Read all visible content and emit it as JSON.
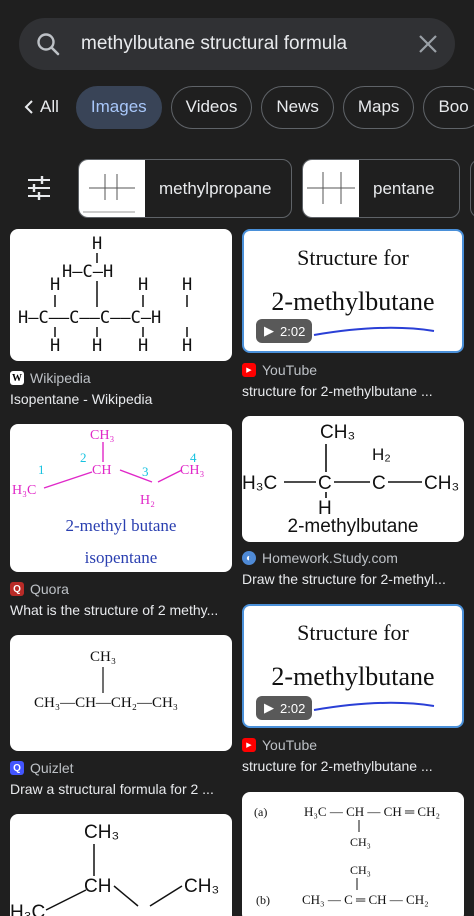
{
  "search": {
    "query": "methylbutane structural formula"
  },
  "tabs": [
    {
      "label": "All"
    },
    {
      "label": "Images"
    },
    {
      "label": "Videos"
    },
    {
      "label": "News"
    },
    {
      "label": "Maps"
    },
    {
      "label": "Boo"
    }
  ],
  "chips": [
    {
      "label": "methylpropane"
    },
    {
      "label": "pentane"
    }
  ],
  "results": [
    {
      "source": "Wikipedia",
      "title": "Isopentane - Wikipedia"
    },
    {
      "source": "YouTube",
      "title": "structure for 2-methylbutane ...",
      "duration": "2:02",
      "image_heading": "Structure for",
      "image_subheading": "2-methylbutane"
    },
    {
      "source": "Quora",
      "title": "What is the structure of 2 methy...",
      "image_text_1": "2-methyl butane",
      "image_text_2": "isopentane"
    },
    {
      "source": "Homework.Study.com",
      "title": "Draw the structure for 2-methyl...",
      "image_text": "2-methylbutane"
    },
    {
      "source": "Quizlet",
      "title": "Draw a structural formula for 2 ..."
    },
    {
      "source": "YouTube",
      "title": "structure for 2-methylbutane ...",
      "duration": "2:02",
      "image_heading": "Structure for",
      "image_subheading": "2-methylbutane"
    }
  ],
  "colors": {
    "youtube": "#ff0000",
    "quora": "#b92b27",
    "homework": "#4f8ad6",
    "quizlet": "#4255ff",
    "accent": "#a8c7fa"
  }
}
